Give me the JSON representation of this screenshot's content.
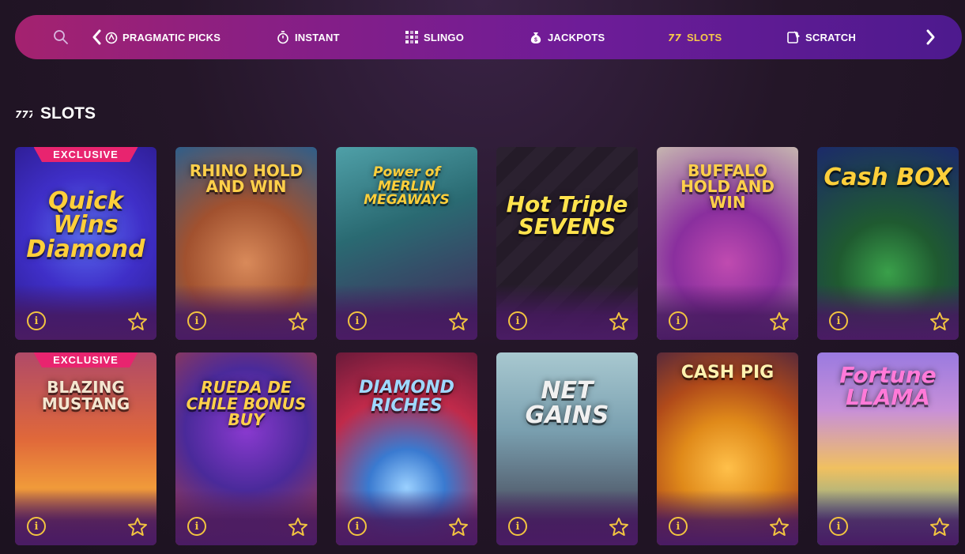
{
  "nav": {
    "items": [
      {
        "label": "PRAGMATIC PICKS",
        "icon": "pragmatic-icon"
      },
      {
        "label": "INSTANT",
        "icon": "stopwatch-icon"
      },
      {
        "label": "SLINGO",
        "icon": "slingo-grid-icon"
      },
      {
        "label": "JACKPOTS",
        "icon": "money-bag-icon"
      },
      {
        "label": "SLOTS",
        "icon": "777-icon",
        "active": true
      },
      {
        "label": "SCRATCH",
        "icon": "scratch-card-icon"
      }
    ]
  },
  "section": {
    "title": "SLOTS",
    "icon": "777-icon"
  },
  "colors": {
    "accent": "#f5c84a",
    "badge": "#e8246f",
    "nav_start": "#a4226f",
    "nav_end": "#4d1a8e"
  },
  "games": [
    {
      "title": "Quick Wins Diamond",
      "badge": "EXCLUSIVE"
    },
    {
      "title": "RHINO HOLD AND WIN"
    },
    {
      "title": "Power of MERLIN MEGAWAYS"
    },
    {
      "title": "Hot Triple SEVENS"
    },
    {
      "title": "BUFFALO HOLD AND WIN"
    },
    {
      "title": "Cash BOX"
    },
    {
      "title": "BLAZING MUSTANG",
      "badge": "EXCLUSIVE"
    },
    {
      "title": "RUEDA DE CHILE BONUS BUY"
    },
    {
      "title": "DIAMOND RICHES"
    },
    {
      "title": "NET GAINS"
    },
    {
      "title": "CASH PIG"
    },
    {
      "title": "Fortune LLAMA"
    }
  ],
  "tile_actions": {
    "info_glyph": "i",
    "info_icon": "info-icon",
    "favorite_icon": "star-icon"
  }
}
